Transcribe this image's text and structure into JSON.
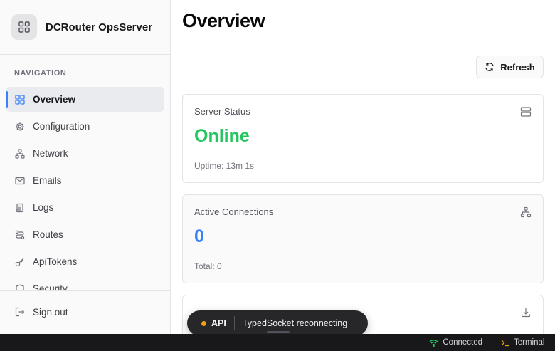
{
  "brand": {
    "name": "DCRouter OpsServer",
    "logo_icon": "grid-icon"
  },
  "nav": {
    "heading": "NAVIGATION",
    "items": [
      {
        "label": "Overview",
        "icon": "grid-icon",
        "active": true
      },
      {
        "label": "Configuration",
        "icon": "gear-icon"
      },
      {
        "label": "Network",
        "icon": "network-icon"
      },
      {
        "label": "Emails",
        "icon": "mail-icon"
      },
      {
        "label": "Logs",
        "icon": "scroll-icon"
      },
      {
        "label": "Routes",
        "icon": "route-icon"
      },
      {
        "label": "ApiTokens",
        "icon": "key-icon"
      },
      {
        "label": "Security",
        "icon": "shield-icon"
      }
    ],
    "signout": "Sign out"
  },
  "main": {
    "title": "Overview",
    "refresh_label": "Refresh",
    "cards": [
      {
        "title": "Server Status",
        "value": "Online",
        "sub": "Uptime: 13m 1s",
        "icon": "server-icon",
        "value_color": "#22c55e"
      },
      {
        "title": "Active Connections",
        "value": "0",
        "sub": "Total: 0",
        "icon": "network-icon",
        "value_color": "#3b82f6"
      },
      {
        "title": "",
        "value": "",
        "sub": "",
        "icon": "download-icon"
      }
    ]
  },
  "toast": {
    "label": "API",
    "message": "TypedSocket reconnecting",
    "dot_color": "#f59e0b"
  },
  "statusbar": {
    "connection": "Connected",
    "terminal": "Terminal"
  },
  "colors": {
    "accent": "#3b82f6",
    "success": "#22c55e",
    "warning": "#f59e0b"
  }
}
